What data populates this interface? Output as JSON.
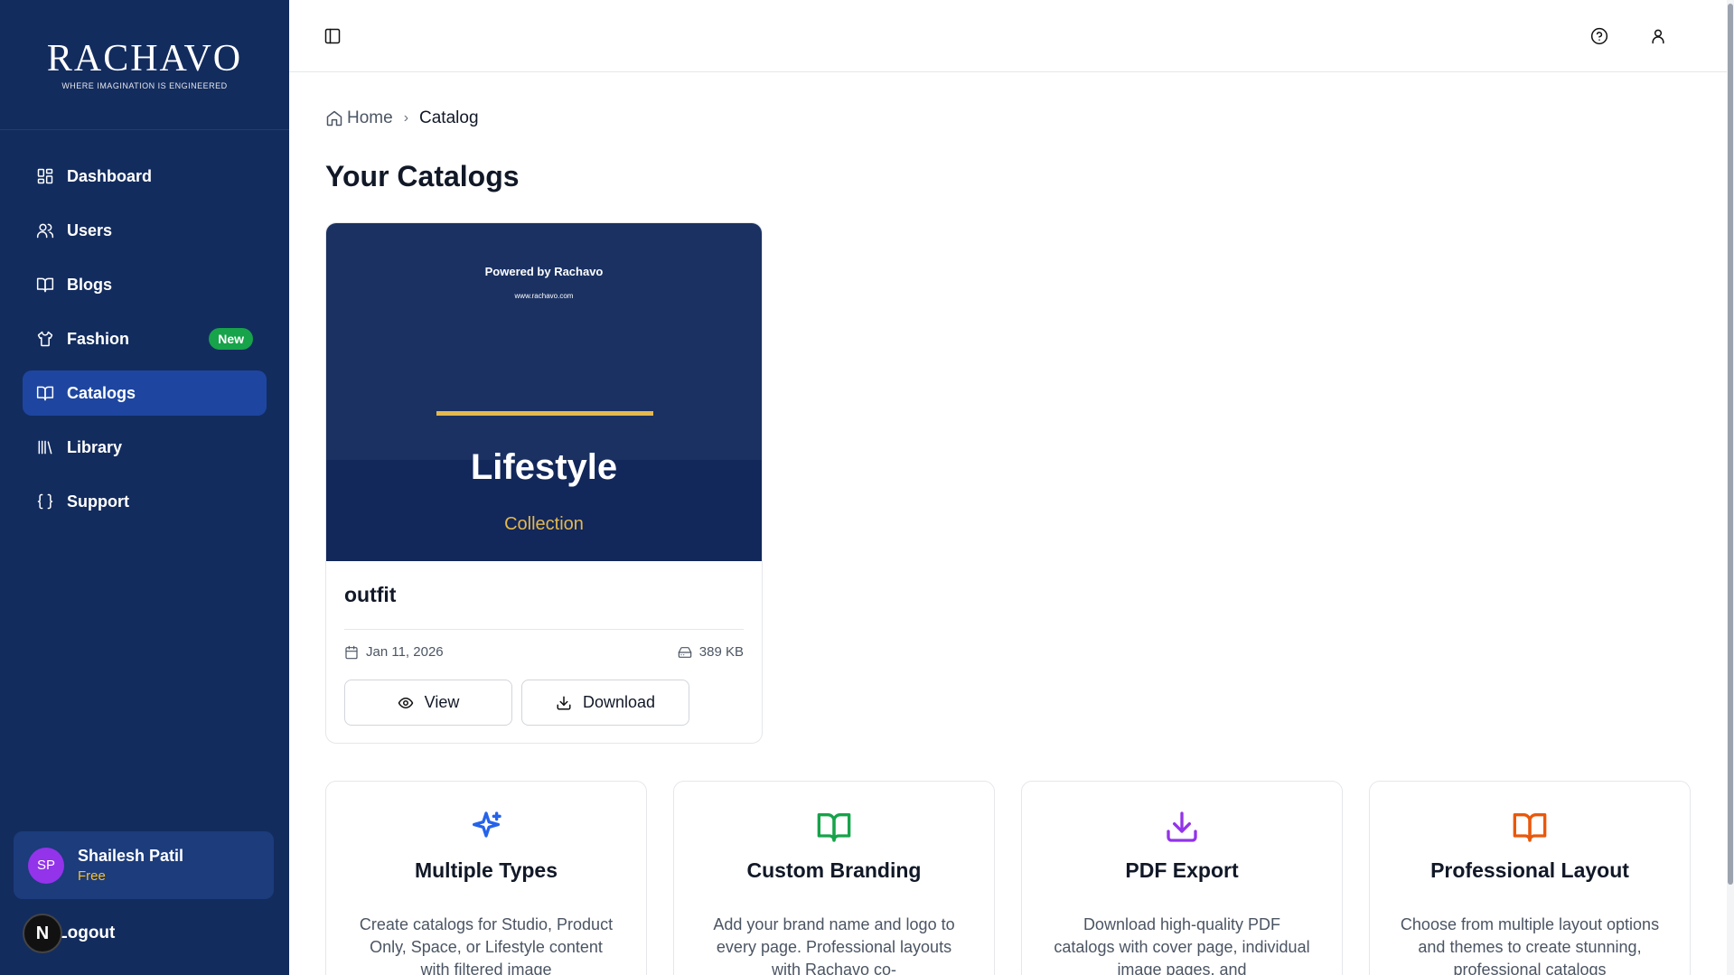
{
  "brand": {
    "name": "RACHAVO",
    "tagline": "WHERE IMAGINATION IS ENGINEERED"
  },
  "sidebar": {
    "items": [
      {
        "label": "Dashboard",
        "icon": "dashboard-icon"
      },
      {
        "label": "Users",
        "icon": "users-icon"
      },
      {
        "label": "Blogs",
        "icon": "book-open-icon"
      },
      {
        "label": "Fashion",
        "icon": "shirt-icon",
        "badge": "New"
      },
      {
        "label": "Catalogs",
        "icon": "book-open-icon",
        "active": true
      },
      {
        "label": "Library",
        "icon": "library-icon"
      },
      {
        "label": "Support",
        "icon": "braces-icon"
      }
    ],
    "user": {
      "initials": "SP",
      "name": "Shailesh Patil",
      "plan": "Free"
    },
    "logout_label": "Logout",
    "dev_badge": "N"
  },
  "breadcrumb": {
    "home": "Home",
    "current": "Catalog"
  },
  "page_title": "Your Catalogs",
  "catalog": {
    "cover": {
      "powered": "Powered by Rachavo",
      "url": "www.rachavo.com",
      "title": "Lifestyle",
      "subtitle": "Collection"
    },
    "name": "outfit",
    "date": "Jan 11, 2026",
    "size": "389 KB",
    "view_label": "View",
    "download_label": "Download"
  },
  "features": [
    {
      "title": "Multiple Types",
      "desc": "Create catalogs for Studio, Product Only, Space, or Lifestyle content with filtered image",
      "icon": "sparkles-icon",
      "color": "#2563eb"
    },
    {
      "title": "Custom Branding",
      "desc": "Add your brand name and logo to every page. Professional layouts with Rachavo co-",
      "icon": "book-open-icon",
      "color": "#16a34a"
    },
    {
      "title": "PDF Export",
      "desc": "Download high-quality PDF catalogs with cover page, individual image pages, and",
      "icon": "download-icon",
      "color": "#9333ea"
    },
    {
      "title": "Professional Layout",
      "desc": "Choose from multiple layout options and themes to create stunning, professional catalogs",
      "icon": "book-open-icon",
      "color": "#ea580c"
    }
  ],
  "colors": {
    "sidebar": "#132c5e",
    "active_nav": "#1e46a0",
    "accent_gold": "#e4b84e",
    "badge_green": "#16a34a"
  }
}
